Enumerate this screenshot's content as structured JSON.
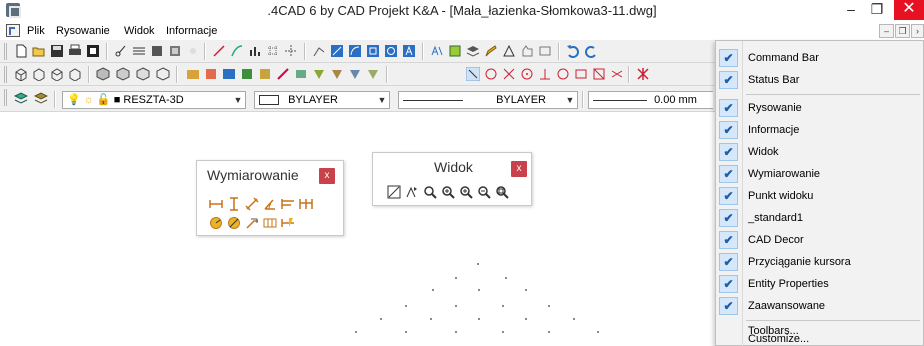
{
  "window": {
    "title": ".4CAD 6 by CAD Projekt K&A - [Mała_łazienka-Słomkowa3-11.dwg]",
    "minimize": "–",
    "maximize": "❐",
    "close": "✕"
  },
  "menubar": {
    "items": [
      {
        "label": "Plik"
      },
      {
        "label": "Rysowanie"
      },
      {
        "label": "Widok"
      },
      {
        "label": "Informacje"
      }
    ],
    "mdi_minimize": "–",
    "mdi_restore": "❐",
    "mdi_more": "›"
  },
  "properties_toolbar": {
    "layer_value": "RESZTA-3D",
    "color_value": "BYLAYER",
    "linetype_value": "BYLAYER",
    "lineweight_value": "0.00 mm"
  },
  "panels": {
    "wymiarowanie": {
      "title": "Wymiarowanie",
      "close": "x"
    },
    "widok": {
      "title": "Widok",
      "close": "x"
    }
  },
  "context_menu": {
    "items": [
      {
        "label": "Command Bar",
        "checked": true
      },
      {
        "label": "Status Bar",
        "checked": true
      },
      {
        "label": "Rysowanie",
        "checked": true
      },
      {
        "label": "Informacje",
        "checked": true
      },
      {
        "label": "Widok",
        "checked": true
      },
      {
        "label": "Wymiarowanie",
        "checked": true
      },
      {
        "label": "Punkt widoku",
        "checked": true
      },
      {
        "label": "_standard1",
        "checked": true
      },
      {
        "label": "CAD Decor",
        "checked": true
      },
      {
        "label": "Przyciąganie kursora",
        "checked": true
      },
      {
        "label": "Entity Properties",
        "checked": true
      },
      {
        "label": "Zaawansowane",
        "checked": true
      },
      {
        "label": "Toolbars...",
        "checked": false
      },
      {
        "label": "Customize...",
        "checked": false
      }
    ],
    "check_glyph": "✔"
  },
  "colors": {
    "accent": "#1f5ea8",
    "close_red": "#e81123",
    "panel_close": "#c9424b"
  }
}
